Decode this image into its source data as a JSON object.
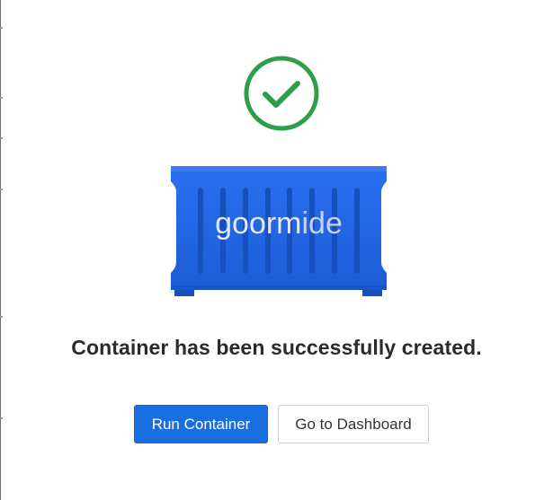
{
  "dialog": {
    "message": "Container has been successfully created.",
    "logo_text_plain": "goorm",
    "logo_text_light": "ide"
  },
  "actions": {
    "run_label": "Run Container",
    "dashboard_label": "Go to Dashboard"
  },
  "colors": {
    "success_green": "#2e9e48",
    "container_blue": "#1f62dd",
    "primary_button": "#1a6fe0"
  },
  "icons": {
    "success": "check-circle-icon",
    "container": "shipping-container-icon"
  }
}
